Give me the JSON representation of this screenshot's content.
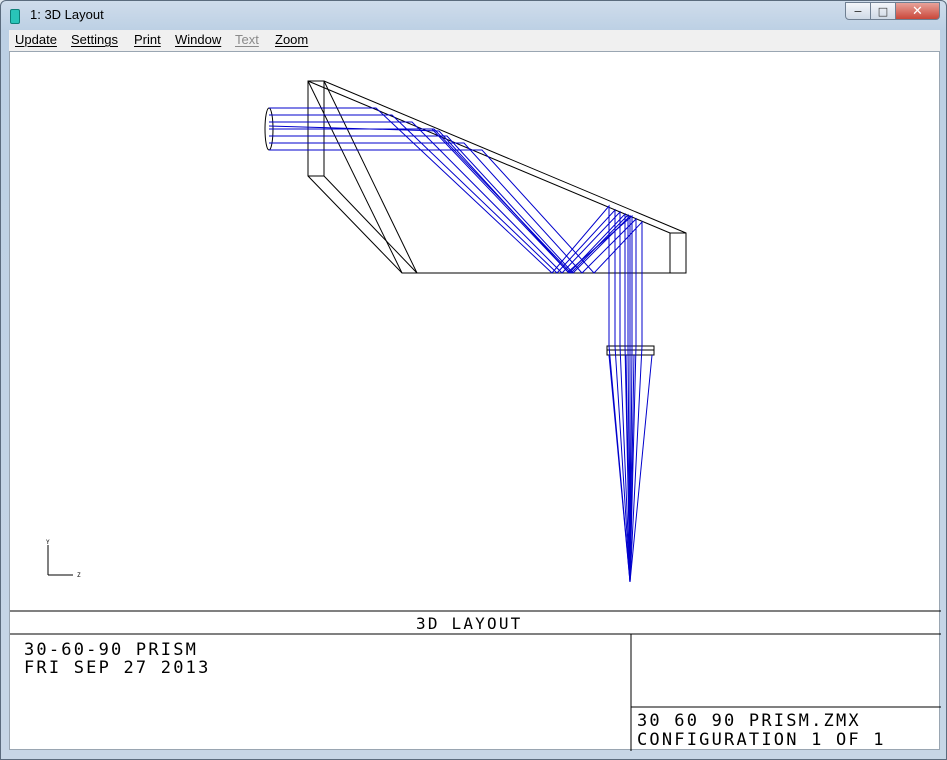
{
  "window": {
    "title": "1: 3D Layout",
    "minimize_symbol": "−",
    "maximize_symbol": "□",
    "close_symbol": "✕"
  },
  "menu": {
    "items": [
      {
        "label": "Update",
        "enabled": true
      },
      {
        "label": "Settings",
        "enabled": true
      },
      {
        "label": "Print",
        "enabled": true
      },
      {
        "label": "Window",
        "enabled": true
      },
      {
        "label": "Text",
        "enabled": false
      },
      {
        "label": "Zoom",
        "enabled": true
      }
    ]
  },
  "plot": {
    "title": "3D LAYOUT",
    "axis_y_label": "Y",
    "axis_z_label": "Z",
    "lens_name": "30-60-90 PRISM",
    "date": "FRI SEP 27 2013",
    "file_name": "30 60 90 PRISM.ZMX",
    "configuration": "CONFIGURATION 1 OF 1",
    "ray_color": "#0000cc",
    "outline_color": "#000000"
  }
}
